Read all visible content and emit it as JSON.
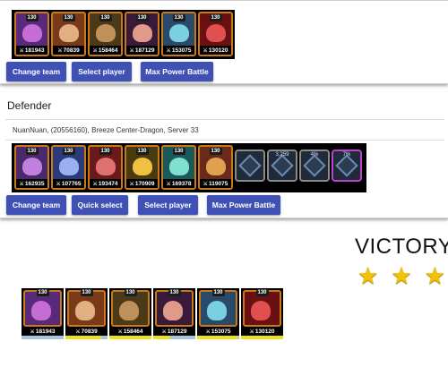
{
  "attacker": {
    "heroes": [
      {
        "level": "130",
        "power": "181943",
        "face": "#c56cd6",
        "bg": "#5a2a7a"
      },
      {
        "level": "130",
        "power": "70839",
        "face": "#e0b080",
        "bg": "#7a3a1a"
      },
      {
        "level": "130",
        "power": "158464",
        "face": "#c0905a",
        "bg": "#4a3a1a"
      },
      {
        "level": "130",
        "power": "187129",
        "face": "#e09a8a",
        "bg": "#3a1a3a"
      },
      {
        "level": "130",
        "power": "153075",
        "face": "#7ad0e0",
        "bg": "#2a4a6a"
      },
      {
        "level": "130",
        "power": "130120",
        "face": "#e05050",
        "bg": "#6a1010"
      }
    ],
    "buttons": {
      "change_team": "Change team",
      "select_player": "Select player",
      "max_power": "Max Power Battle"
    }
  },
  "defender": {
    "title": "Defender",
    "player": "NuanNuan, (20556160), Breeze Center-Dragon, Server 33",
    "heroes": [
      {
        "level": "130",
        "power": "162935",
        "face": "#c080e0",
        "bg": "#4a2a6a"
      },
      {
        "level": "130",
        "power": "107765",
        "face": "#9ab0f0",
        "bg": "#2a3a7a"
      },
      {
        "level": "130",
        "power": "193474",
        "face": "#e07070",
        "bg": "#6a1a1a"
      },
      {
        "level": "130",
        "power": "170909",
        "face": "#f0c040",
        "bg": "#4a3a10"
      },
      {
        "level": "130",
        "power": "169378",
        "face": "#80e0d0",
        "bg": "#1a5a5a"
      },
      {
        "level": "130",
        "power": "119075",
        "face": "#e0a050",
        "bg": "#6a2a1a"
      }
    ],
    "pets": [
      {
        "label": "",
        "purple": false
      },
      {
        "label": "3,259",
        "purple": false
      },
      {
        "label": "4%",
        "purple": false
      },
      {
        "label": "7%",
        "purple": true
      }
    ],
    "buttons": {
      "change_team": "Change team",
      "quick_select": "Quick select",
      "select_player": "Select player",
      "max_power": "Max Power Battle"
    }
  },
  "result": {
    "text": "VICTORY!",
    "stars": 3,
    "heroes": [
      {
        "power": "181943",
        "hp": 0.0,
        "face": "#c56cd6",
        "bg": "#5a2a7a"
      },
      {
        "power": "70839",
        "hp": 0.85,
        "face": "#e0b080",
        "bg": "#7a3a1a"
      },
      {
        "power": "158464",
        "hp": 1.0,
        "face": "#c0905a",
        "bg": "#4a3a1a"
      },
      {
        "power": "187129",
        "hp": 0.4,
        "face": "#e09a8a",
        "bg": "#3a1a3a"
      },
      {
        "power": "153075",
        "hp": 0.95,
        "face": "#7ad0e0",
        "bg": "#2a4a6a"
      },
      {
        "power": "130120",
        "hp": 1.0,
        "face": "#e05050",
        "bg": "#6a1010"
      }
    ]
  },
  "colors": {
    "button": "#3f51b5",
    "star": "#f4c400",
    "hp_fill": "#e8e31c"
  }
}
